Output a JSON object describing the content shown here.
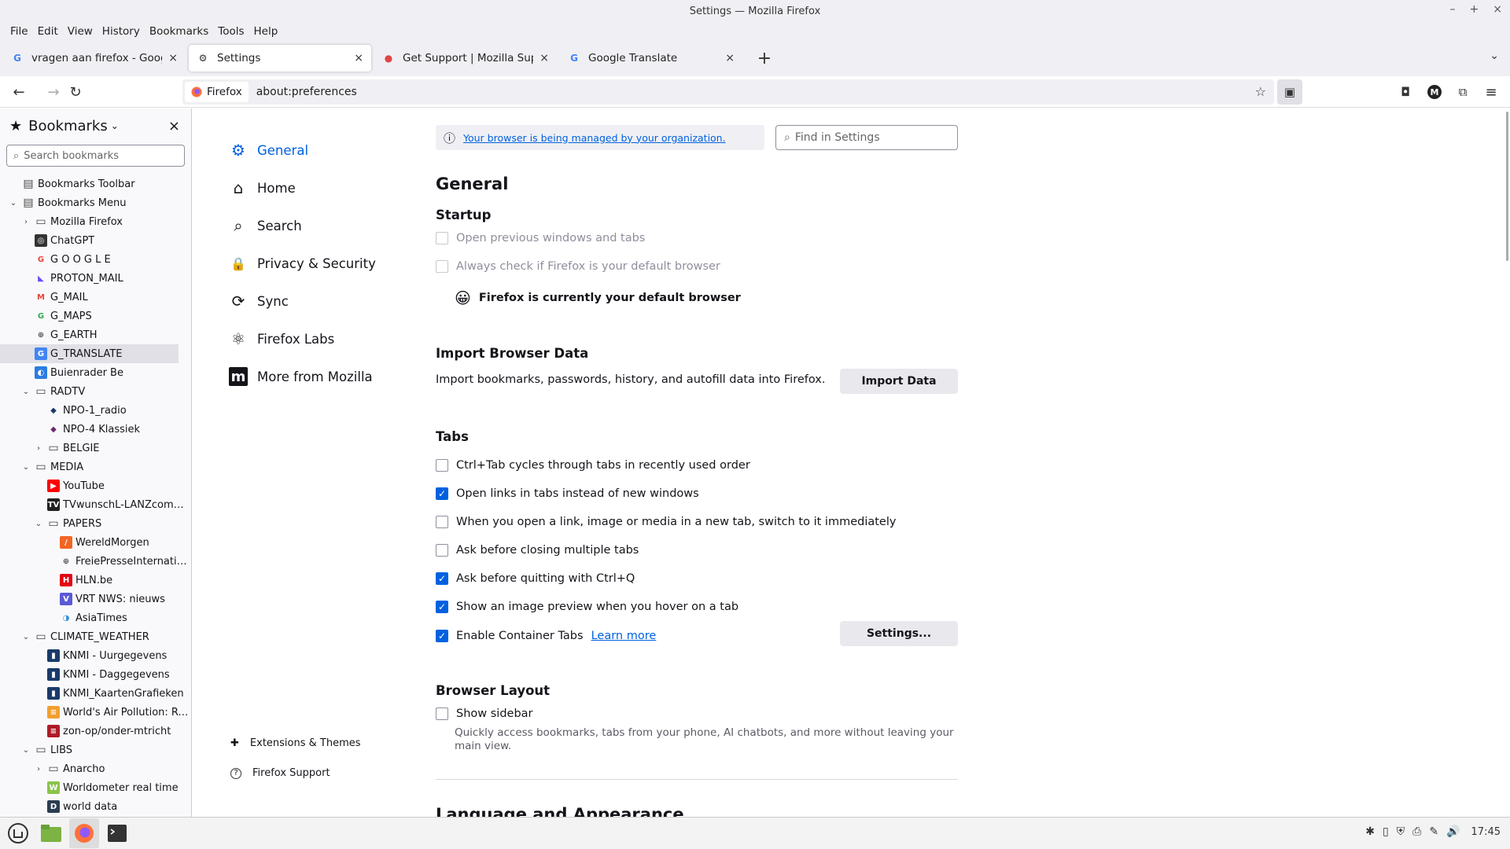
{
  "window": {
    "title": "Settings — Mozilla Firefox",
    "minimize": "–",
    "maximize": "+",
    "close": "×"
  },
  "menu": [
    "File",
    "Edit",
    "View",
    "History",
    "Bookmarks",
    "Tools",
    "Help"
  ],
  "tabs": [
    {
      "label": "vragen aan firefox - Google Zoeken",
      "icon": "G",
      "color": "#4285f4"
    },
    {
      "label": "Settings",
      "icon": "⚙",
      "color": "#333333"
    },
    {
      "label": "Get Support | Mozilla Support",
      "icon": "●",
      "color": "#e04545"
    },
    {
      "label": "Google Translate",
      "icon": "G",
      "color": "#4285f4"
    }
  ],
  "tab_close": "×",
  "new_tab": "+",
  "tab_list": "⌄",
  "nav": {
    "back": "←",
    "forward": "→",
    "reload": "↻"
  },
  "url": {
    "identity": "Firefox",
    "text": "about:preferences",
    "star": "☆"
  },
  "toolbar": {
    "sidebar": "▣",
    "pocket": "◘",
    "account": "M",
    "extensions": "⧉",
    "menu": "≡"
  },
  "sidebar": {
    "title": "Bookmarks",
    "title_icon": "★",
    "caret": "⌄",
    "close": "×",
    "search_placeholder": "Search bookmarks",
    "items": [
      {
        "label": "Bookmarks Toolbar",
        "depth": 0,
        "twisty": "",
        "icon": "▤",
        "bg": "",
        "fg": "#444444"
      },
      {
        "label": "Bookmarks Menu",
        "depth": 0,
        "twisty": "⌄",
        "icon": "▤",
        "bg": "",
        "fg": "#444444"
      },
      {
        "label": "Mozilla Firefox",
        "depth": 1,
        "twisty": "›",
        "icon": "▭",
        "bg": "",
        "fg": "#444444"
      },
      {
        "label": "ChatGPT",
        "depth": 1,
        "twisty": "",
        "icon": "◎",
        "bg": "#333333",
        "fg": "#ffffff"
      },
      {
        "label": "G O O G L E",
        "depth": 1,
        "twisty": "",
        "icon": "G",
        "bg": "",
        "fg": "#ea4335"
      },
      {
        "label": "PROTON_MAIL",
        "depth": 1,
        "twisty": "",
        "icon": "◣",
        "bg": "",
        "fg": "#6d4aff"
      },
      {
        "label": "G_MAIL",
        "depth": 1,
        "twisty": "",
        "icon": "M",
        "bg": "",
        "fg": "#ea4335"
      },
      {
        "label": "G_MAPS",
        "depth": 1,
        "twisty": "",
        "icon": "G",
        "bg": "",
        "fg": "#34a853"
      },
      {
        "label": "G_EARTH",
        "depth": 1,
        "twisty": "",
        "icon": "⊕",
        "bg": "",
        "fg": "#555555"
      },
      {
        "label": "G_TRANSLATE",
        "depth": 1,
        "twisty": "",
        "icon": "G",
        "bg": "#4285f4",
        "fg": "#ffffff",
        "selected": true
      },
      {
        "label": "Buienrader Be",
        "depth": 1,
        "twisty": "",
        "icon": "◐",
        "bg": "#2a7de1",
        "fg": "#ffffff"
      },
      {
        "label": "RADTV",
        "depth": 1,
        "twisty": "⌄",
        "icon": "▭",
        "bg": "",
        "fg": "#444444"
      },
      {
        "label": "NPO-1_radio",
        "depth": 2,
        "twisty": "",
        "icon": "◆",
        "bg": "",
        "fg": "#1b3a6b"
      },
      {
        "label": "NPO-4 Klassiek",
        "depth": 2,
        "twisty": "",
        "icon": "◆",
        "bg": "",
        "fg": "#6a2a6a"
      },
      {
        "label": "BELGIE",
        "depth": 2,
        "twisty": "›",
        "icon": "▭",
        "bg": "",
        "fg": "#444444"
      },
      {
        "label": "MEDIA",
        "depth": 1,
        "twisty": "⌄",
        "icon": "▭",
        "bg": "",
        "fg": "#444444"
      },
      {
        "label": "YouTube",
        "depth": 2,
        "twisty": "",
        "icon": "▶",
        "bg": "#ff0000",
        "fg": "#ffffff"
      },
      {
        "label": "TVwunschL-LANZcomme...",
        "depth": 2,
        "twisty": "",
        "icon": "TV",
        "bg": "#222222",
        "fg": "#ffffff"
      },
      {
        "label": "PAPERS",
        "depth": 2,
        "twisty": "⌄",
        "icon": "▭",
        "bg": "",
        "fg": "#444444"
      },
      {
        "label": "WereldMorgen",
        "depth": 3,
        "twisty": "",
        "icon": "/",
        "bg": "#f26522",
        "fg": "#ffffff"
      },
      {
        "label": "FreiePresseInternatio...",
        "depth": 3,
        "twisty": "",
        "icon": "⊕",
        "bg": "",
        "fg": "#555555"
      },
      {
        "label": "HLN.be",
        "depth": 3,
        "twisty": "",
        "icon": "H",
        "bg": "#e30613",
        "fg": "#ffffff"
      },
      {
        "label": "VRT NWS: nieuws",
        "depth": 3,
        "twisty": "",
        "icon": "V",
        "bg": "#5a5ad6",
        "fg": "#ffffff"
      },
      {
        "label": "AsiaTimes",
        "depth": 3,
        "twisty": "",
        "icon": "◑",
        "bg": "",
        "fg": "#3a8fd6"
      },
      {
        "label": "CLIMATE_WEATHER",
        "depth": 1,
        "twisty": "⌄",
        "icon": "▭",
        "bg": "",
        "fg": "#444444"
      },
      {
        "label": "KNMI - Uurgegevens",
        "depth": 2,
        "twisty": "",
        "icon": "▮",
        "bg": "#1a3a6a",
        "fg": "#ffffff"
      },
      {
        "label": "KNMI - Daggegevens",
        "depth": 2,
        "twisty": "",
        "icon": "▮",
        "bg": "#1a3a6a",
        "fg": "#ffffff"
      },
      {
        "label": "KNMI_KaartenGrafieken",
        "depth": 2,
        "twisty": "",
        "icon": "▮",
        "bg": "#1a3a6a",
        "fg": "#ffffff"
      },
      {
        "label": "World's Air Pollution: Re...",
        "depth": 2,
        "twisty": "",
        "icon": "≡",
        "bg": "#f0a030",
        "fg": "#ffffff"
      },
      {
        "label": "zon-op/onder-mtricht",
        "depth": 2,
        "twisty": "",
        "icon": "≡",
        "bg": "#ae1c28",
        "fg": "#ffffff"
      },
      {
        "label": "LIBS",
        "depth": 1,
        "twisty": "⌄",
        "icon": "▭",
        "bg": "",
        "fg": "#444444"
      },
      {
        "label": "Anarcho",
        "depth": 2,
        "twisty": "›",
        "icon": "▭",
        "bg": "",
        "fg": "#444444"
      },
      {
        "label": "Worldometer real time",
        "depth": 2,
        "twisty": "",
        "icon": "W",
        "bg": "#8bc34a",
        "fg": "#ffffff"
      },
      {
        "label": "world data",
        "depth": 2,
        "twisty": "",
        "icon": "D",
        "bg": "#2c3e50",
        "fg": "#ffffff"
      }
    ]
  },
  "categories": [
    {
      "label": "General",
      "icon": "⚙",
      "name": "general",
      "active": true
    },
    {
      "label": "Home",
      "icon": "⌂",
      "name": "home"
    },
    {
      "label": "Search",
      "icon": "⌕",
      "name": "search"
    },
    {
      "label": "Privacy & Security",
      "icon": "🔒",
      "name": "privacy-security"
    },
    {
      "label": "Sync",
      "icon": "⟳",
      "name": "sync"
    },
    {
      "label": "Firefox Labs",
      "icon": "⚛",
      "name": "firefox-labs"
    },
    {
      "label": "More from Mozilla",
      "icon": "m",
      "name": "more-from-mozilla"
    }
  ],
  "footer_links": [
    {
      "label": "Extensions & Themes",
      "icon": "✚",
      "name": "extensions-themes"
    },
    {
      "label": "Firefox Support",
      "icon": "?",
      "name": "firefox-support"
    }
  ],
  "settings": {
    "managed_text": "Your browser is being managed by your organization.",
    "managed_icon": "ⓘ",
    "find_placeholder": "Find in Settings",
    "find_icon": "⌕",
    "title": "General",
    "startup": {
      "heading": "Startup",
      "open_previous": "Open previous windows and tabs",
      "always_check": "Always check if Firefox is your default browser",
      "default_status": "Firefox is currently your default browser",
      "smiley": "😀"
    },
    "import": {
      "heading": "Import Browser Data",
      "desc": "Import bookmarks, passwords, history, and autofill data into Firefox.",
      "button": "Import Data"
    },
    "tabs": {
      "heading": "Tabs",
      "options": [
        {
          "label": "Ctrl+Tab cycles through tabs in recently used order",
          "checked": false
        },
        {
          "label": "Open links in tabs instead of new windows",
          "checked": true
        },
        {
          "label": "When you open a link, image or media in a new tab, switch to it immediately",
          "checked": false
        },
        {
          "label": "Ask before closing multiple tabs",
          "checked": false
        },
        {
          "label": "Ask before quitting with Ctrl+Q",
          "checked": true
        },
        {
          "label": "Show an image preview when you hover on a tab",
          "checked": true
        },
        {
          "label": "Enable Container Tabs",
          "checked": true
        }
      ],
      "learn_more": "Learn more",
      "settings_button": "Settings..."
    },
    "layout": {
      "heading": "Browser Layout",
      "show_sidebar": "Show sidebar",
      "show_sidebar_checked": false,
      "sidebar_desc": "Quickly access bookmarks, tabs from your phone, AI chatbots, and more without leaving your main view."
    },
    "language_heading": "Language and Appearance"
  },
  "checkmark": "✓",
  "taskbar": {
    "clock": "17:45",
    "tray": [
      "✱",
      "▯",
      "⛨",
      "⎙",
      "✎",
      "🔊"
    ]
  },
  "colors": {
    "accent": "#0061e0",
    "chrome": "#f0f0f4"
  }
}
